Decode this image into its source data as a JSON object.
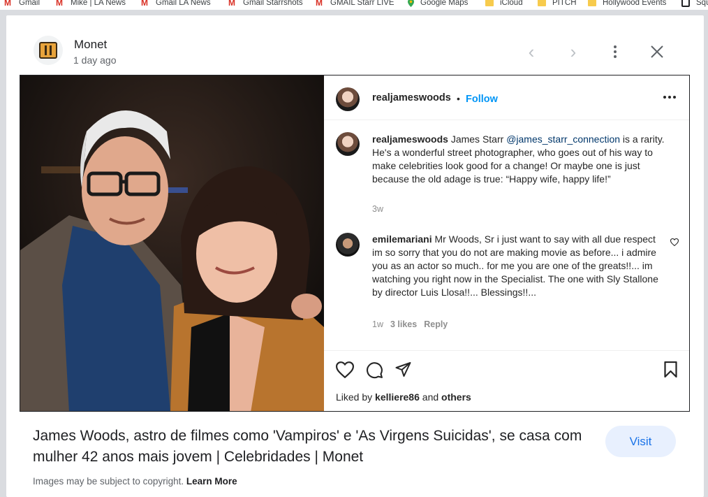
{
  "bookmarks": [
    {
      "label": "Gmail",
      "icon": "gmail-icon"
    },
    {
      "label": "Mike | LA News",
      "icon": "gmail-icon"
    },
    {
      "label": "Gmail LA News",
      "icon": "gmail-icon"
    },
    {
      "label": "Gmail Starrshots",
      "icon": "gmail-icon"
    },
    {
      "label": "GMAIL Starr LIVE",
      "icon": "gmail-icon"
    },
    {
      "label": "Google Maps",
      "icon": "maps-pin-icon"
    },
    {
      "label": "iCloud",
      "icon": "folder-icon"
    },
    {
      "label": "PITCH",
      "icon": "folder-icon"
    },
    {
      "label": "Hollywood Events",
      "icon": "folder-icon"
    },
    {
      "label": "Squ",
      "icon": "square-icon"
    }
  ],
  "header": {
    "site_name": "Monet",
    "time_ago": "1 day ago"
  },
  "instagram": {
    "username": "realjameswoods",
    "separator": "•",
    "follow_label": "Follow",
    "caption": {
      "user": "realjameswoods",
      "text_before": " James Starr ",
      "mention": "@james_starr_connection",
      "text_after": " is a rarity. He's a wonderful street photographer, who goes out of his way to make celebrities look good for a change! Or maybe one is just because the old adage is true: “Happy wife, happy life!”",
      "age": "3w"
    },
    "comment": {
      "user": "emilemariani",
      "text": " Mr Woods, Sr i just want to say with all due respect im so sorry that you do not are making movie as before... i admire you as an actor so much.. for me you are one of the greats!!... im watching you right now in the Specialist. The one with Sly Stallone by director Luis Llosa!!... Blessings!!...",
      "age": "1w",
      "likes": "3 likes",
      "reply": "Reply"
    },
    "liked_prefix": "Liked by ",
    "liked_user": "kelliere86",
    "liked_mid": " and ",
    "liked_others": "others"
  },
  "result": {
    "title": "James Woods, astro de filmes como 'Vampiros' e 'As Virgens Suicidas', se casa com mulher 42 anos mais jovem | Celebridades | Monet",
    "visit_label": "Visit",
    "copyright_text": "Images may be subject to copyright. ",
    "learn_more": "Learn More"
  },
  "colors": {
    "accent": "#1a73e8",
    "visit_bg": "#e8f0fe",
    "instagram_blue": "#0095f6",
    "mention": "#00376b"
  }
}
